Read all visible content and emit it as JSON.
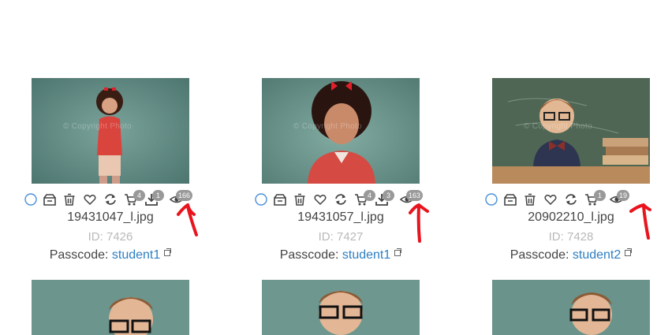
{
  "photos": [
    {
      "filename": "19431047_l.jpg",
      "id": "ID: 7426",
      "passcode_label": "Passcode:",
      "passcode": "student1",
      "cart_count": "4",
      "download_count": "1",
      "view_count": "166"
    },
    {
      "filename": "19431057_l.jpg",
      "id": "ID: 7427",
      "passcode_label": "Passcode:",
      "passcode": "student1",
      "cart_count": "4",
      "download_count": "3",
      "view_count": "163"
    },
    {
      "filename": "20902210_l.jpg",
      "id": "ID: 7428",
      "passcode_label": "Passcode:",
      "passcode": "student2",
      "cart_count": "1",
      "download_count": "",
      "view_count": "19"
    }
  ],
  "watermark": "© Copyright Photo",
  "colors": {
    "link": "#2e7ec2",
    "badge": "#999999",
    "annotation": "#e8141e",
    "select_circle": "#4a90d9"
  },
  "icons": [
    "select-circle-icon",
    "crop-icon",
    "trash-icon",
    "heart-icon",
    "refresh-icon",
    "cart-icon",
    "download-icon",
    "eye-icon"
  ]
}
